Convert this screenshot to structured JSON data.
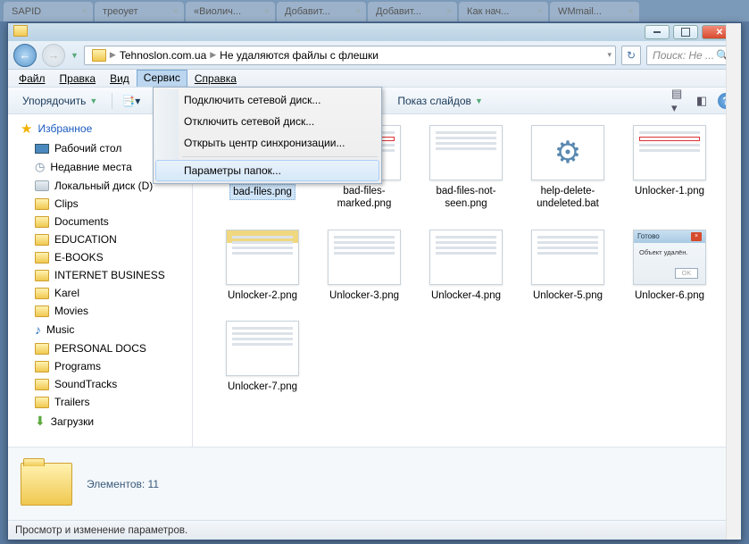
{
  "browser_tabs": [
    "SAPID",
    "треоует",
    "«Виолич...",
    "Добавит...",
    "Добавит...",
    "Как нач...",
    "WMmail..."
  ],
  "breadcrumb": [
    "Tehnoslon.com.ua",
    "Не удаляются файлы с флешки"
  ],
  "search_placeholder": "Поиск: Не ...",
  "menubar": {
    "file": "Файл",
    "edit": "Правка",
    "view": "Вид",
    "service": "Сервис",
    "help": "Справка"
  },
  "service_menu": {
    "map_drive": "Подключить сетевой диск...",
    "unmap_drive": "Отключить сетевой диск...",
    "sync_center": "Открыть центр синхронизации...",
    "folder_options": "Параметры папок..."
  },
  "toolbar": {
    "organize": "Упорядочить",
    "slideshow": "Показ слайдов"
  },
  "sidebar": {
    "favorites": "Избранное",
    "items": [
      {
        "label": "Рабочий стол",
        "icon": "desktop"
      },
      {
        "label": "Недавние места",
        "icon": "clock"
      },
      {
        "label": "Локальный диск (D)",
        "icon": "disk"
      },
      {
        "label": "Clips",
        "icon": "folder"
      },
      {
        "label": "Documents",
        "icon": "folder"
      },
      {
        "label": "EDUCATION",
        "icon": "folder"
      },
      {
        "label": "E-BOOKS",
        "icon": "folder"
      },
      {
        "label": "INTERNET BUSINESS",
        "icon": "folder"
      },
      {
        "label": "Karel",
        "icon": "folder"
      },
      {
        "label": "Movies",
        "icon": "folder"
      },
      {
        "label": "Music",
        "icon": "music"
      },
      {
        "label": "PERSONAL DOCS",
        "icon": "folder"
      },
      {
        "label": "Programs",
        "icon": "folder"
      },
      {
        "label": "SoundTracks",
        "icon": "folder"
      },
      {
        "label": "Trailers",
        "icon": "folder"
      },
      {
        "label": "Загрузки",
        "icon": "download"
      }
    ]
  },
  "files": [
    {
      "name": "bad-files.png",
      "kind": "lines",
      "selected": true
    },
    {
      "name": "bad-files-marked.png",
      "kind": "redbox"
    },
    {
      "name": "bad-files-not-seen.png",
      "kind": "lines"
    },
    {
      "name": "help-delete-undeleted.bat",
      "kind": "gear"
    },
    {
      "name": "Unlocker-1.png",
      "kind": "redbox"
    },
    {
      "name": "Unlocker-2.png",
      "kind": "yellowbar"
    },
    {
      "name": "Unlocker-3.png",
      "kind": "lines"
    },
    {
      "name": "Unlocker-4.png",
      "kind": "lines"
    },
    {
      "name": "Unlocker-5.png",
      "kind": "lines"
    },
    {
      "name": "Unlocker-6.png",
      "kind": "dialog",
      "dlg_title": "Готово",
      "dlg_text": "Объект удалён.",
      "dlg_btn": "OK"
    },
    {
      "name": "Unlocker-7.png",
      "kind": "lines"
    }
  ],
  "details": {
    "count_label": "Элементов: 11"
  },
  "statusbar": "Просмотр и изменение параметров."
}
